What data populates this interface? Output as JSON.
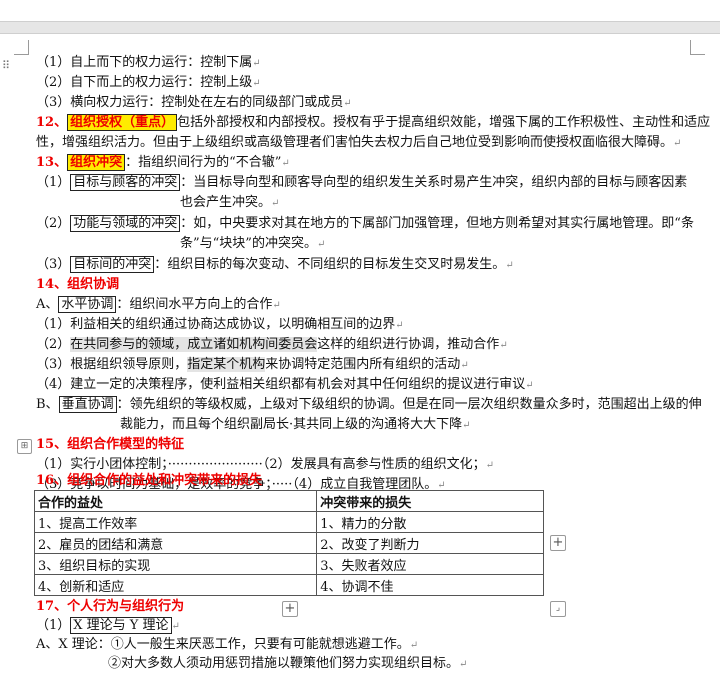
{
  "lines": {
    "l1": "（1）自上而下的权力运行：控制下属",
    "l2": "（2）自下而上的权力运行：控制上级",
    "l3": "（3）横向权力运行：控制处在左右的同级部门或成员",
    "s12_num": "12、",
    "s12_term": "组织授权（重点）",
    "s12_a": "包括外部授权和内部授权。授权有乎于提高组织效能，增强下属的工作积极性、主动性和适应",
    "s12_b": "性，增强组织活力。但由于上级组织或高级管理者们害怕失去权力后自己地位受到影响而使授权面临很大障碍。",
    "s13_num": "13、",
    "s13_term": "组织冲突",
    "s13_a": "：指组织间行为的“不合辙”",
    "c1_pre": "（1）",
    "c1_box": "目标与顾客的冲突",
    "c1_a": "：当目标导向型和顾客导向型的组织发生关系时易产生冲突，组织内部的目标与顾客因素",
    "c1_b": "也会产生冲突。",
    "c2_pre": "（2）",
    "c2_box": "功能与领域的冲突",
    "c2_a": "：如，中央要求对其在地方的下属部门加强管理，但地方则希望对其实行属地管理。即“条",
    "c2_b": "条”与“块块”的冲突突。",
    "c3_pre": "（3）",
    "c3_box": "目标间的冲突",
    "c3_a": "：组织目标的每次变动、不同组织的目标发生交叉时易发生。",
    "s14": "14、组织协调",
    "a_pre": "A、",
    "a_box": "水平协调",
    "a_txt": "：组织间水平方向上的合作",
    "a1": "（1）利益相关的组织通过协商达成协议，以明确相互间的边界",
    "a2_pre": "（2）",
    "a2_hl": "在共同参与的领域，成立诸如机构间委员会",
    "a2_post": "这样的组织进行协调，推动合作",
    "a3_pre": "（3）根据组织领导原则，",
    "a3_hl": "指定某个机构",
    "a3_post": "来协调特定范围内所有组织的活动",
    "a4": "（4）建立一定的决策程序，使利益相关组织都有机会对其中任何组织的提议进行审议",
    "b_pre": "B、",
    "b_box": "垂直协调",
    "b_a": "：领先组织的等级权威，上级对下级组织的协调。但是在同一层次组织数量众多时，范围超出上级的伸",
    "b_b": "裁能力，而且每个组织副局长·其共同上级的沟通将大大下降",
    "s15": "15、组织合作模型的特征",
    "f1": "（1）实行小团体控制；·······················（2）发展具有高参与性质的组织文化；",
    "f2": "（3）竞争以时间为基础，是效率的竞争；·····（4）成立自我管理团队。",
    "s16": "16、组织合作的益处和冲突带来的损失",
    "s17": "17、个人行为与组织行为",
    "x1_pre": "（1）",
    "x1_box": "X 理论与 Y 理论",
    "x2": "A、X 理论：①人一般生来厌恶工作，只要有可能就想逃避工作。",
    "x3": "②对大多数人须动用惩罚措施以鞭策他们努力实现组织目标。"
  },
  "table": {
    "headers": [
      "合作的益处",
      "冲突带来的损失"
    ],
    "rows": [
      [
        "1、提高工作效率",
        "1、精力的分散"
      ],
      [
        "2、雇员的团结和满意",
        "2、改变了判断力"
      ],
      [
        "3、组织目标的实现",
        "3、失败者效应"
      ],
      [
        "4、创新和适应",
        "4、协调不佳"
      ]
    ]
  },
  "icons": {
    "add_row": "+",
    "add_col": "+",
    "table_handle": "⊞",
    "drag": "⠿"
  }
}
